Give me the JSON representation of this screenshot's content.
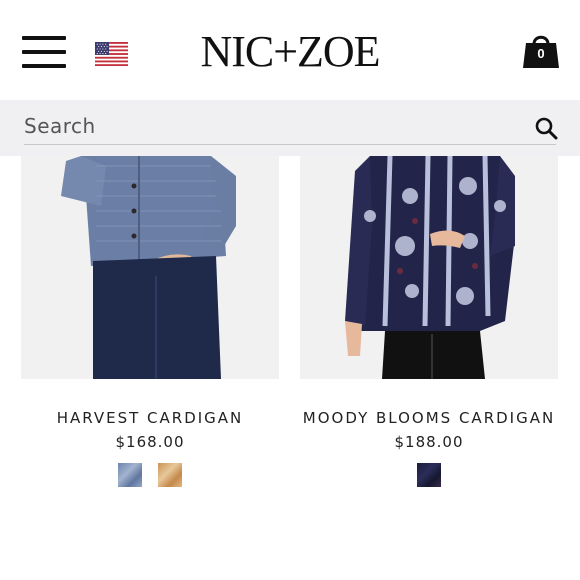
{
  "header": {
    "logo": "NIC+ZOE",
    "bag_count": "0",
    "flag_icon": "us-flag-icon",
    "menu_icon": "hamburger-menu-icon",
    "bag_icon": "shopping-bag-icon"
  },
  "search": {
    "placeholder": "Search",
    "icon": "search-icon"
  },
  "products": [
    {
      "name": "HARVEST CARDIGAN",
      "price": "$168.00",
      "swatches": [
        "#7d93b5",
        "#d4a56a"
      ]
    },
    {
      "name": "MOODY BLOOMS CARDIGAN",
      "price": "$188.00",
      "swatches": [
        "#1d1f3f"
      ]
    }
  ]
}
